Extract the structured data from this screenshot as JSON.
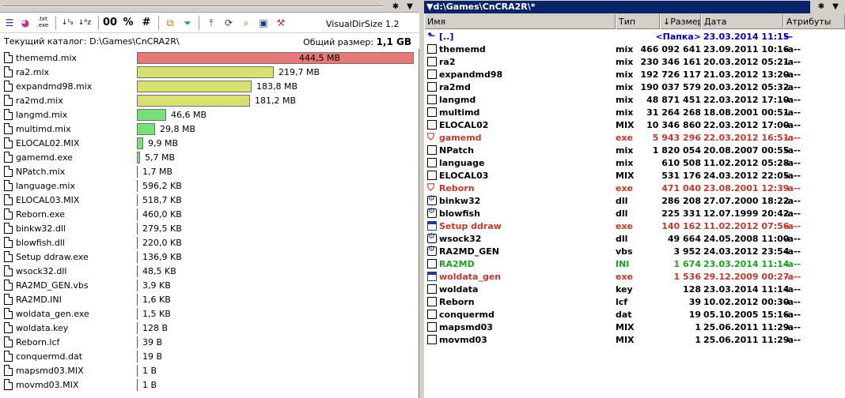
{
  "left_panel": {
    "toolbar": {
      "exe_icon_label": ".txt .exe",
      "btn_00": "00",
      "btn_percent": "%",
      "btn_hash": "#",
      "title": "VisualDirSize  1.2"
    },
    "titlebar": {
      "pin": "✱",
      "dropdown": "▼"
    },
    "current_dir": "Текущий каталог: D:\\Games\\CnCRA2R\\",
    "total_label": "Общий размер:",
    "total_value": "1,1 GB",
    "files": [
      {
        "name": "thememd.mix",
        "size": "444,5 MB",
        "fraction": 1.0,
        "color": "#e87878"
      },
      {
        "name": "ra2.mix",
        "size": "219,7 MB",
        "fraction": 0.494,
        "color": "#d8e070"
      },
      {
        "name": "expandmd98.mix",
        "size": "183,8 MB",
        "fraction": 0.4135,
        "color": "#d8e070"
      },
      {
        "name": "ra2md.mix",
        "size": "181,2 MB",
        "fraction": 0.4077,
        "color": "#d8e070"
      },
      {
        "name": "langmd.mix",
        "size": "46,6 MB",
        "fraction": 0.1048,
        "color": "#78e078"
      },
      {
        "name": "multimd.mix",
        "size": "29,8 MB",
        "fraction": 0.067,
        "color": "#78e078"
      },
      {
        "name": "ELOCAL02.MIX",
        "size": "9,9 MB",
        "fraction": 0.0223,
        "color": "#78e078"
      },
      {
        "name": "gamemd.exe",
        "size": "5,7 MB",
        "fraction": 0.0128,
        "color": "#78e078"
      },
      {
        "name": "NPatch.mix",
        "size": "1,7 MB",
        "fraction": 0.0038,
        "color": "#78e078"
      },
      {
        "name": "language.mix",
        "size": "596,2 KB",
        "fraction": 0.0013,
        "color": "#78e078"
      },
      {
        "name": "ELOCAL03.MIX",
        "size": "518,7 KB",
        "fraction": 0.0012,
        "color": "#78e078"
      },
      {
        "name": "Reborn.exe",
        "size": "460,0 KB",
        "fraction": 0.001,
        "color": "#78e078"
      },
      {
        "name": "binkw32.dll",
        "size": "279,5 KB",
        "fraction": 0.0006,
        "color": "#78e078"
      },
      {
        "name": "blowfish.dll",
        "size": "220,0 KB",
        "fraction": 0.0005,
        "color": "#78e078"
      },
      {
        "name": "Setup ddraw.exe",
        "size": "136,9 KB",
        "fraction": 0.0003,
        "color": "#78e078"
      },
      {
        "name": "wsock32.dll",
        "size": "48,5 KB",
        "fraction": 0.0001,
        "color": "#78e078"
      },
      {
        "name": "RA2MD_GEN.vbs",
        "size": "3,9 KB",
        "fraction": 0.0,
        "color": "#78e078"
      },
      {
        "name": "RA2MD.INI",
        "size": "1,6 KB",
        "fraction": 0.0,
        "color": "#78e078"
      },
      {
        "name": "woldata_gen.exe",
        "size": "1,5 KB",
        "fraction": 0.0,
        "color": "#78e078"
      },
      {
        "name": "woldata.key",
        "size": "128 B",
        "fraction": 0.0,
        "color": "#78e078"
      },
      {
        "name": "Reborn.lcf",
        "size": "39 B",
        "fraction": 0.0,
        "color": "#78e078"
      },
      {
        "name": "conquermd.dat",
        "size": "19 B",
        "fraction": 0.0,
        "color": "#78e078"
      },
      {
        "name": "mapsmd03.MIX",
        "size": "1 B",
        "fraction": 0.0,
        "color": "#78e078"
      },
      {
        "name": "movmd03.MIX",
        "size": "1 B",
        "fraction": 0.0,
        "color": "#78e078"
      }
    ]
  },
  "right_panel": {
    "path": "▼d:\\Games\\CnCRA2R\\*",
    "titlebar": {
      "pin": "✱",
      "dropdown": "▼"
    },
    "columns": {
      "name": "Имя",
      "ext": "Тип",
      "size": "↓Размер",
      "date": "Дата",
      "attr": "Атрибуты"
    },
    "rows": [
      {
        "name": "[..]",
        "ext": "",
        "size": "<Папка>",
        "date": "23.03.2014 11:15",
        "attr": "—",
        "color": "blue",
        "icon": "up"
      },
      {
        "name": "thememd",
        "ext": "mix",
        "size": "466 092 641",
        "date": "23.09.2011 10:16",
        "attr": "-a--",
        "color": "",
        "icon": "file"
      },
      {
        "name": "ra2",
        "ext": "mix",
        "size": "230 346 161",
        "date": "20.03.2012 05:21",
        "attr": "-a--",
        "color": "",
        "icon": "file"
      },
      {
        "name": "expandmd98",
        "ext": "mix",
        "size": "192 726 117",
        "date": "21.03.2012 13:20",
        "attr": "-a--",
        "color": "",
        "icon": "file"
      },
      {
        "name": "ra2md",
        "ext": "mix",
        "size": "190 037 579",
        "date": "20.03.2012 05:32",
        "attr": "-a--",
        "color": "",
        "icon": "file"
      },
      {
        "name": "langmd",
        "ext": "mix",
        "size": "48 871 451",
        "date": "22.03.2012 17:10",
        "attr": "-a--",
        "color": "",
        "icon": "file"
      },
      {
        "name": "multimd",
        "ext": "mix",
        "size": "31 264 268",
        "date": "18.08.2001 00:51",
        "attr": "-a--",
        "color": "",
        "icon": "file"
      },
      {
        "name": "ELOCAL02",
        "ext": "MIX",
        "size": "10 346 860",
        "date": "22.03.2012 17:00",
        "attr": "-a--",
        "color": "",
        "icon": "file"
      },
      {
        "name": "gamemd",
        "ext": "exe",
        "size": "5 943 296",
        "date": "22.03.2012 16:51",
        "attr": "-a--",
        "color": "red",
        "icon": "exe"
      },
      {
        "name": "NPatch",
        "ext": "mix",
        "size": "1 820 054",
        "date": "20.08.2007 00:55",
        "attr": "-a--",
        "color": "",
        "icon": "file"
      },
      {
        "name": "language",
        "ext": "mix",
        "size": "610 508",
        "date": "11.02.2012 05:28",
        "attr": "-a--",
        "color": "",
        "icon": "file"
      },
      {
        "name": "ELOCAL03",
        "ext": "MIX",
        "size": "531 176",
        "date": "24.03.2012 22:05",
        "attr": "-a--",
        "color": "",
        "icon": "file"
      },
      {
        "name": "Reborn",
        "ext": "exe",
        "size": "471 040",
        "date": "23.08.2001 12:39",
        "attr": "-a--",
        "color": "red",
        "icon": "exe"
      },
      {
        "name": "binkw32",
        "ext": "dll",
        "size": "286 208",
        "date": "27.07.2000 18:22",
        "attr": "-a--",
        "color": "",
        "icon": "gear"
      },
      {
        "name": "blowfish",
        "ext": "dll",
        "size": "225 331",
        "date": "12.07.1999 20:42",
        "attr": "-a--",
        "color": "",
        "icon": "gear"
      },
      {
        "name": "Setup ddraw",
        "ext": "exe",
        "size": "140 162",
        "date": "11.02.2012 07:56",
        "attr": "-a--",
        "color": "red",
        "icon": "win"
      },
      {
        "name": "wsock32",
        "ext": "dll",
        "size": "49 664",
        "date": "24.05.2008 11:00",
        "attr": "-a--",
        "color": "",
        "icon": "gear"
      },
      {
        "name": "RA2MD_GEN",
        "ext": "vbs",
        "size": "3 952",
        "date": "24.03.2012 23:54",
        "attr": "-a--",
        "color": "",
        "icon": "gear"
      },
      {
        "name": "RA2MD",
        "ext": "INI",
        "size": "1 674",
        "date": "23.03.2014 11:14",
        "attr": "-a--",
        "color": "green",
        "icon": "file"
      },
      {
        "name": "woldata_gen",
        "ext": "exe",
        "size": "1 536",
        "date": "29.12.2009 00:27",
        "attr": "-a--",
        "color": "red",
        "icon": "win"
      },
      {
        "name": "woldata",
        "ext": "key",
        "size": "128",
        "date": "23.03.2014 11:14",
        "attr": "-a--",
        "color": "",
        "icon": "file"
      },
      {
        "name": "Reborn",
        "ext": "lcf",
        "size": "39",
        "date": "10.02.2012 00:30",
        "attr": "-a--",
        "color": "",
        "icon": "file"
      },
      {
        "name": "conquermd",
        "ext": "dat",
        "size": "19",
        "date": "05.10.2005 15:16",
        "attr": "-a--",
        "color": "",
        "icon": "file"
      },
      {
        "name": "mapsmd03",
        "ext": "MIX",
        "size": "1",
        "date": "25.06.2011 11:29",
        "attr": "-a--",
        "color": "",
        "icon": "file"
      },
      {
        "name": "movmd03",
        "ext": "MIX",
        "size": "1",
        "date": "25.06.2011 11:29",
        "attr": "-a--",
        "color": "",
        "icon": "file"
      }
    ]
  }
}
